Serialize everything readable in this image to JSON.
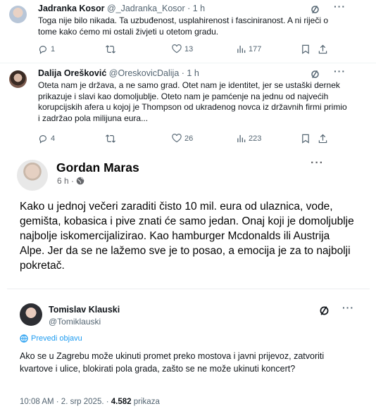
{
  "tweet1": {
    "name": "Jadranka Kosor",
    "handle": "@_Jadranka_Kosor",
    "time": "· 1 h",
    "text": "Toga nije bilo nikada. Ta uzbuđenost, usplahirenost i fasciniranost. A ni riječi o tome kako ćemo mi ostali živjeti u otetom gradu.",
    "replies": "1",
    "retweets": "",
    "likes": "13",
    "views": "177"
  },
  "tweet2": {
    "name": "Dalija Orešković",
    "handle": "@OreskovicDalija",
    "time": "· 1 h",
    "text": "Oteta nam je država, a ne samo grad. Otet nam je identitet, jer se ustaški dernek prikazuje i slavi kao domoljublje. Oteto nam je pamćenje na jednu od najvećih korupcijskih afera u kojoj je Thompson od ukradenog novca iz državnih firmi primio i zadržao pola milijuna eura...",
    "replies": "4",
    "retweets": "",
    "likes": "26",
    "views": "223"
  },
  "fb_post": {
    "name": "Gordan Maras",
    "time": "6 h ·",
    "text": "Kako u jednoj večeri zaraditi čisto 10 mil. eura od ulaznica, vode, gemišta, kobasica i pive znati će samo jedan. Onaj koji je domoljublje najbolje iskomercijalizirao. Kao hamburger Mcdonalds ili Austrija Alpe. Jer da se ne lažemo sve je to posao, a emocija je za to najbolji pokretač."
  },
  "embedded": {
    "name": "Tomislav Klauski",
    "handle": "@Tomiklauski",
    "translate_label": "Prevedi objavu",
    "text": "Ako se u Zagrebu može ukinuti promet preko mostova i javni prijevoz, zatvoriti kvartove i ulice, blokirati pola grada, zašto se ne može ukinuti koncert?",
    "timestamp": "10:08 AM · 2. srp 2025. ·",
    "views_count": "4.582",
    "views_label": "prikaza"
  },
  "icons": [
    "grok-icon",
    "more-icon",
    "reply-icon",
    "retweet-icon",
    "like-icon",
    "views-icon",
    "bookmark-icon",
    "share-icon",
    "globe-icon",
    "translate-icon"
  ],
  "colors": {
    "text": "#0f1419",
    "secondary": "#536471",
    "link": "#1d9bf0",
    "fb_text": "#050505",
    "fb_secondary": "#65676b"
  }
}
